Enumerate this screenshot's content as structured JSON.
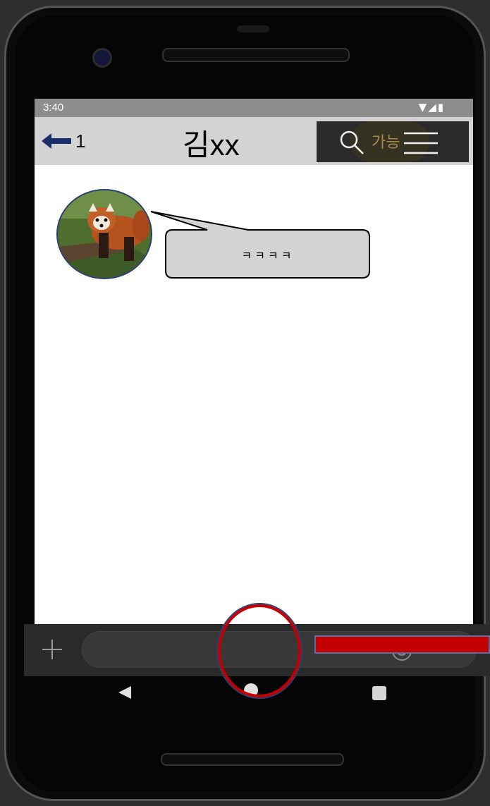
{
  "status_bar": {
    "time": "3:40",
    "icons": "▼◢▮"
  },
  "header": {
    "unread_count": "1",
    "title": "김xx",
    "search_hint": "가능"
  },
  "messages": [
    {
      "text": "ㅋㅋㅋㅋ"
    }
  ],
  "composer": {
    "plus": "+",
    "input_value": "",
    "hash": "#"
  },
  "colors": {
    "appbar": "#d3d3d3",
    "status_bar": "#8d8d8d",
    "bubble": "#d3d3d3",
    "annotation_red": "#c40000",
    "annotation_blue": "#2c3e73"
  },
  "icons": {
    "back": "arrow-left-icon",
    "search": "search-icon",
    "menu": "hamburger-menu-icon",
    "plus": "plus-icon",
    "emoji": "emoji-icon",
    "hash": "hash-icon"
  }
}
